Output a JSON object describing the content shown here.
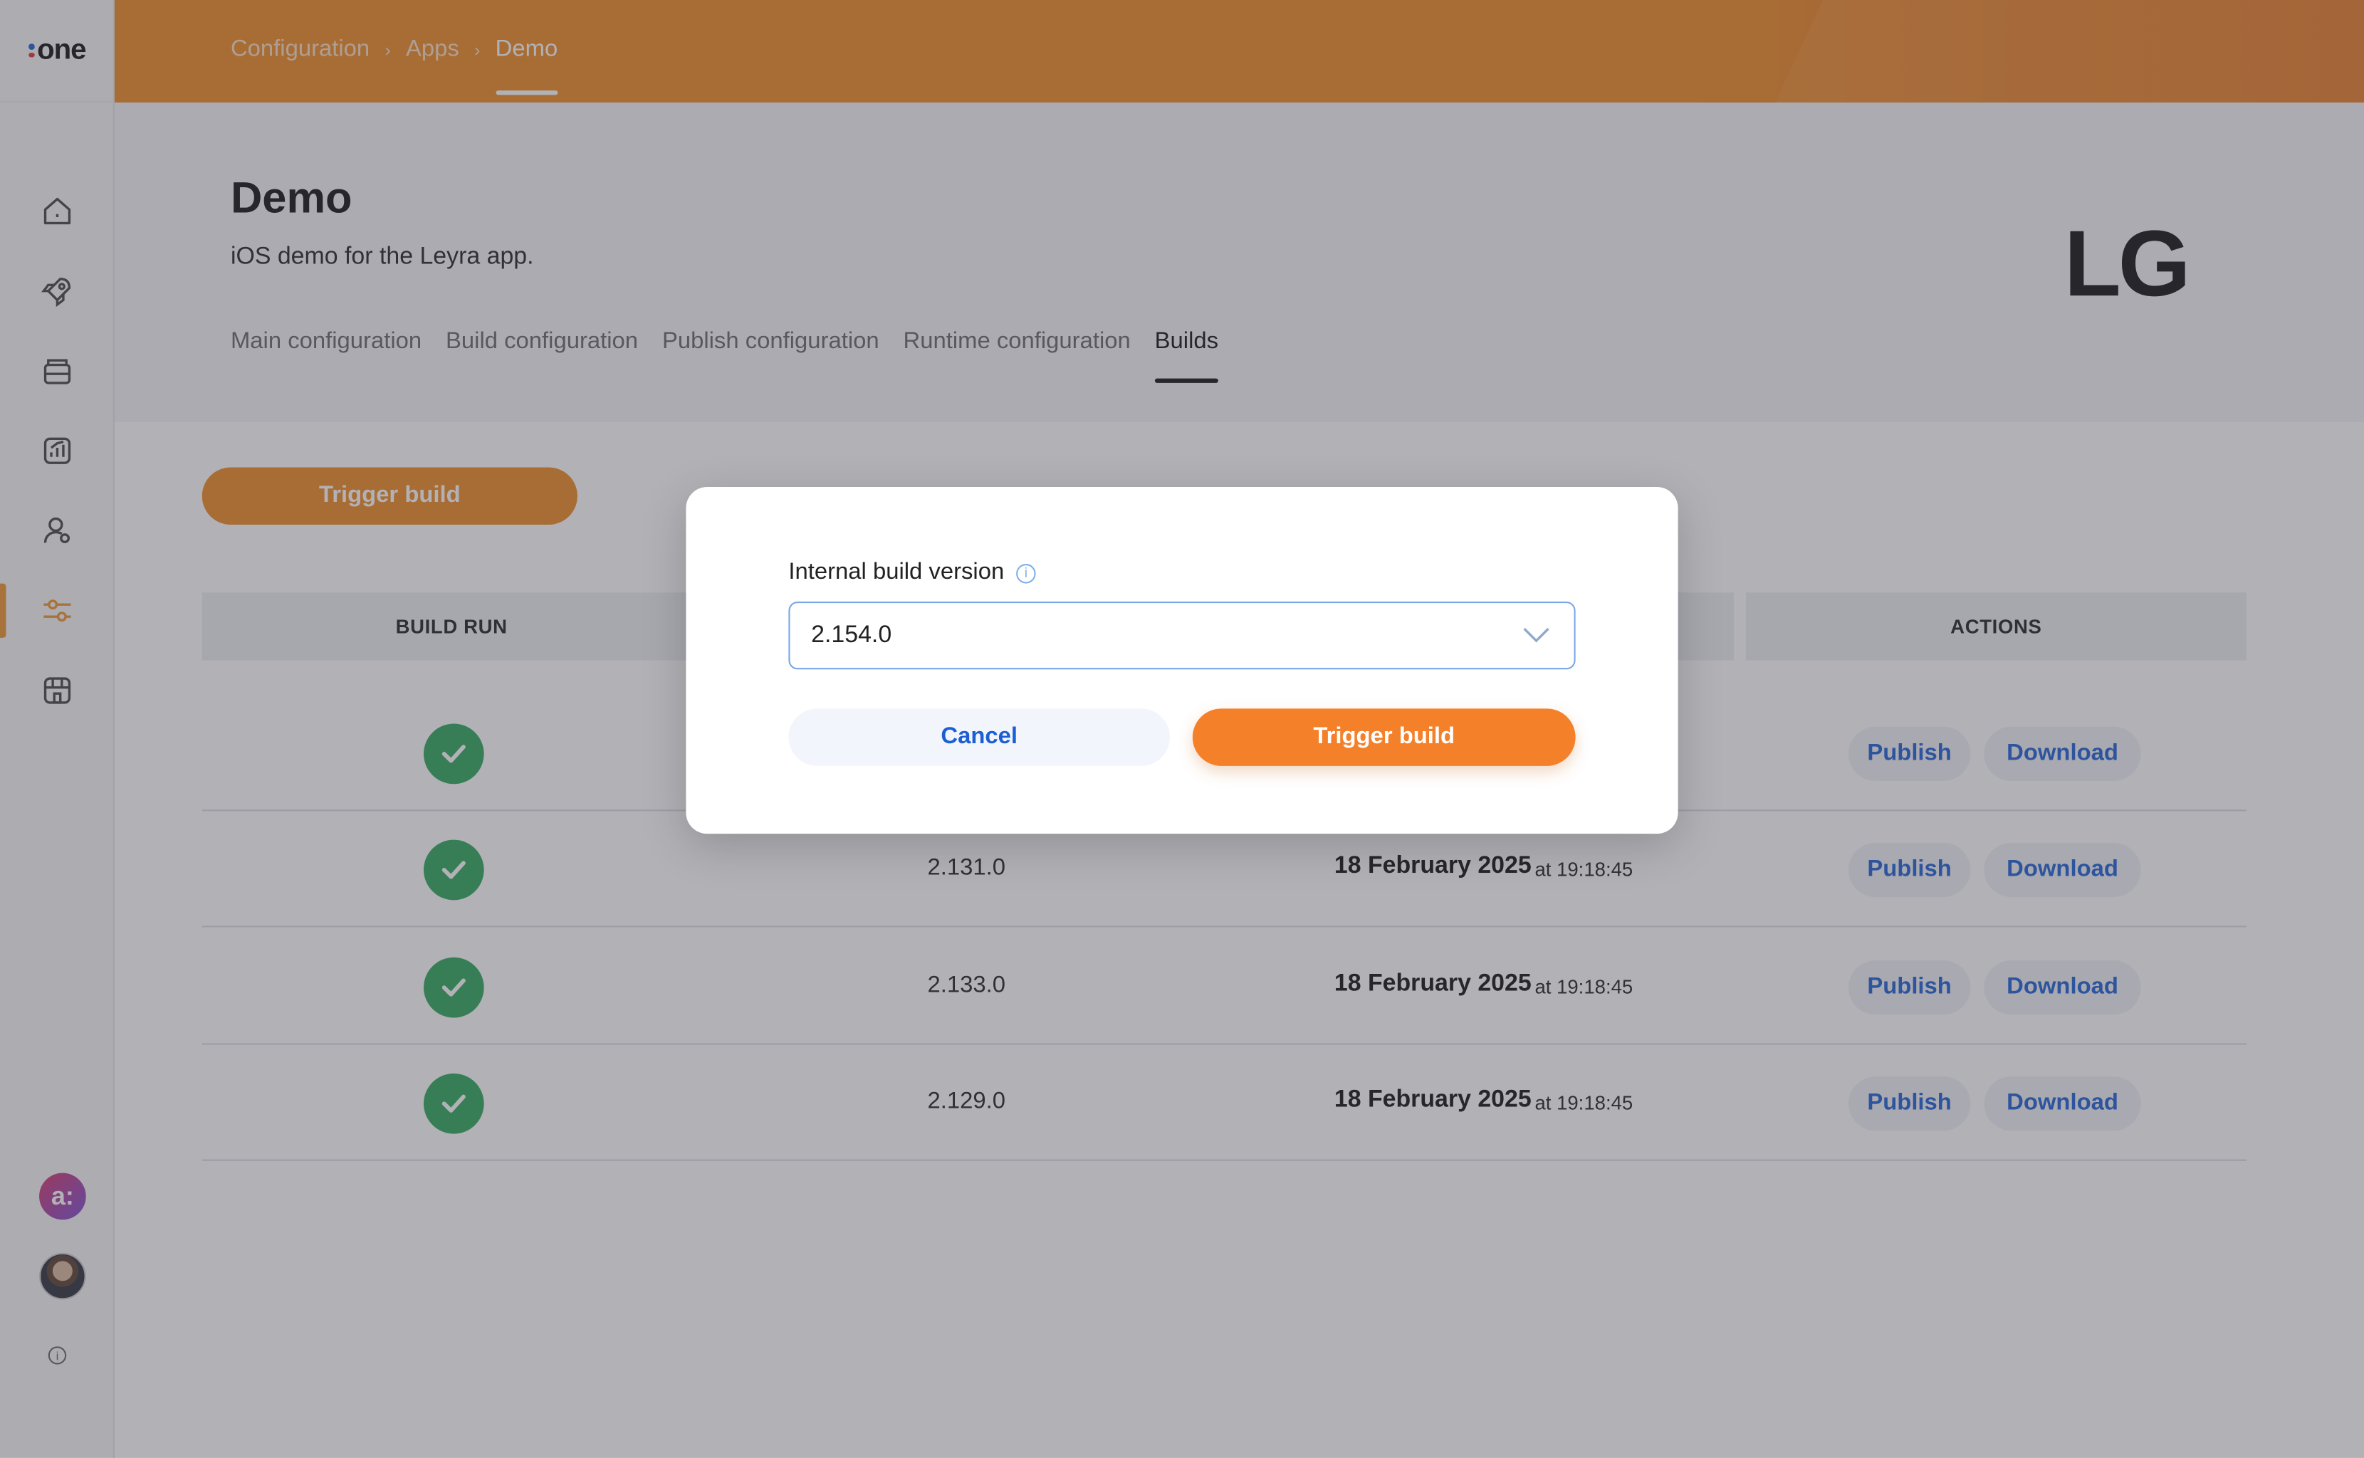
{
  "brand": {
    "logo_text": "one",
    "accent": "#f08a22",
    "dot_colors": [
      "#1c5fd4",
      "#e0303a"
    ]
  },
  "breadcrumb": [
    "Configuration",
    "Apps",
    "Demo"
  ],
  "sidebar": {
    "items": [
      {
        "icon": "home-icon"
      },
      {
        "icon": "rocket-icon"
      },
      {
        "icon": "folder-icon"
      },
      {
        "icon": "analytics-icon"
      },
      {
        "icon": "users-icon"
      },
      {
        "icon": "sliders-icon",
        "active": true
      },
      {
        "icon": "store-icon"
      }
    ],
    "org_avatar_text": "a:"
  },
  "page": {
    "title": "Demo",
    "description": "iOS demo for the Leyra app.",
    "brand_logo": "LG"
  },
  "tabs": [
    {
      "label": "Main configuration"
    },
    {
      "label": "Build configuration"
    },
    {
      "label": "Publish configuration"
    },
    {
      "label": "Runtime configuration"
    },
    {
      "label": "Builds",
      "active": true
    }
  ],
  "main": {
    "trigger_button": "Trigger build",
    "columns": [
      "BUILD RUN",
      "",
      "",
      "ACTIONS"
    ],
    "rows": [
      {
        "status": "success",
        "version": "",
        "date": "",
        "time": "",
        "publish": "Publish",
        "download": "Download"
      },
      {
        "status": "success",
        "version": "2.131.0",
        "date": "18 February 2025",
        "time": "at 19:18:45",
        "publish": "Publish",
        "download": "Download"
      },
      {
        "status": "success",
        "version": "2.133.0",
        "date": "18 February 2025",
        "time": "at 19:18:45",
        "publish": "Publish",
        "download": "Download"
      },
      {
        "status": "success",
        "version": "2.129.0",
        "date": "18 February 2025",
        "time": "at 19:18:45",
        "publish": "Publish",
        "download": "Download"
      }
    ]
  },
  "modal": {
    "field_label": "Internal build version",
    "selected_version": "2.154.0",
    "cancel_label": "Cancel",
    "confirm_label": "Trigger build"
  }
}
